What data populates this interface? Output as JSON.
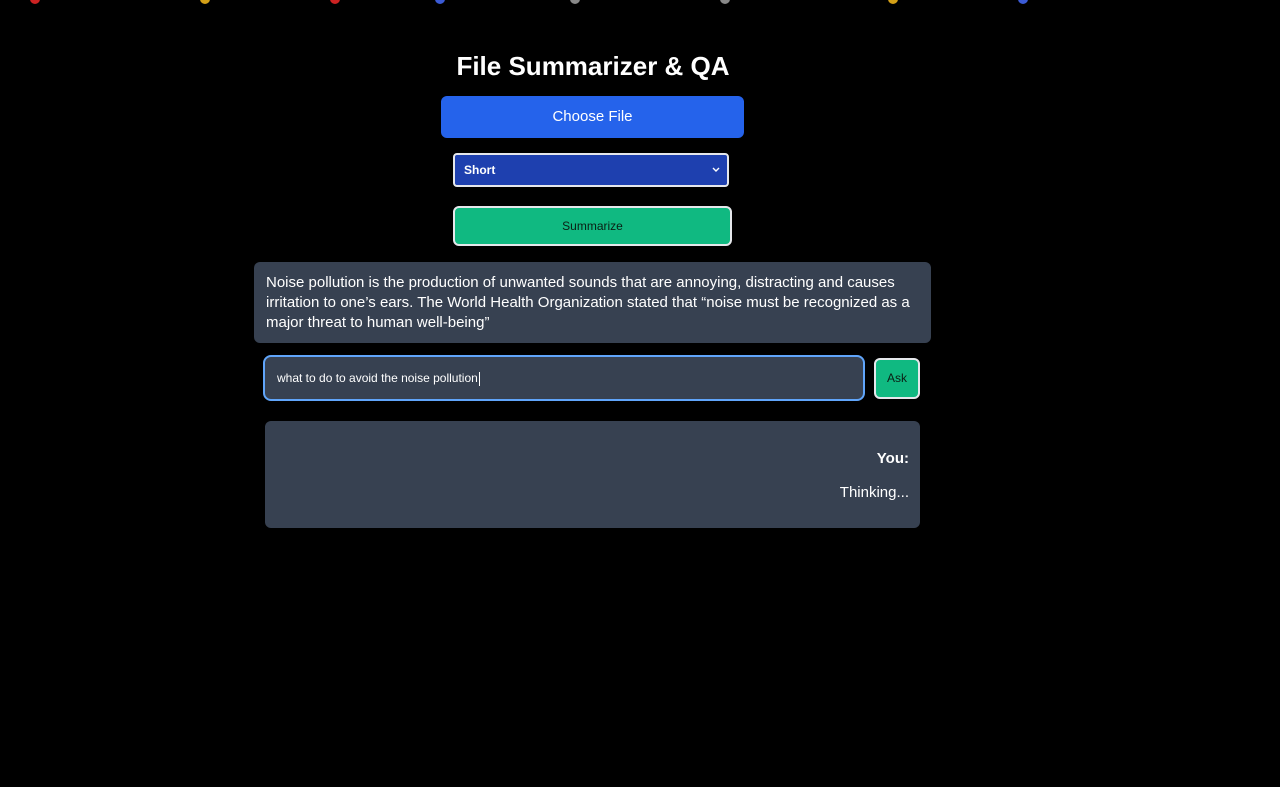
{
  "app": {
    "title": "File Summarizer & QA"
  },
  "upload": {
    "choose_file_label": "Choose File"
  },
  "summary_length": {
    "selected": "Short"
  },
  "summarize": {
    "button_label": "Summarize"
  },
  "summary": {
    "text": "Noise pollution is the production of unwanted sounds that are annoying, distracting and causes irritation to one’s ears. The World Health Organization stated that “noise must be recognized as a major threat to human well-being”"
  },
  "qa": {
    "question_value": "what to do to avoid the noise pollution",
    "ask_label": "Ask"
  },
  "chat": {
    "sender": "You:",
    "message": "Thinking..."
  },
  "colors": {
    "background": "#000000",
    "primary_blue": "#2563eb",
    "select_blue": "#1e40af",
    "green": "#10b981",
    "panel": "#374151",
    "focus_ring": "#60a5fa"
  }
}
